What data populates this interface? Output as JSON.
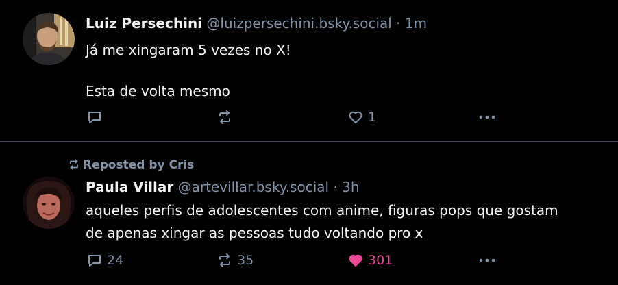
{
  "colors": {
    "background": "#000000",
    "text": "#f1f3f5",
    "muted": "#8193a8",
    "like": "#ec4899",
    "divider": "#2e4052"
  },
  "posts": [
    {
      "author_name": "Luiz Persechini",
      "handle": "@luizpersechini.bsky.social",
      "separator": "·",
      "time": "1m",
      "lines": [
        "Já me xingaram 5 vezes no X!",
        "Esta de volta mesmo"
      ],
      "actions": {
        "reply": {
          "icon": "reply-icon",
          "count": ""
        },
        "repost": {
          "icon": "repost-icon",
          "count": ""
        },
        "like": {
          "icon": "heart-outline-icon",
          "count": "1"
        },
        "more": {
          "icon": "more-icon"
        }
      }
    },
    {
      "reposted_by": "Reposted by Cris",
      "author_name": "Paula Villar",
      "handle": "@artevillar.bsky.social",
      "separator": "·",
      "time": "3h",
      "lines": [
        "aqueles perfis de adolescentes com anime, figuras pops que gostam",
        "de apenas xingar as pessoas tudo voltando pro x"
      ],
      "actions": {
        "reply": {
          "icon": "reply-icon",
          "count": "24"
        },
        "repost": {
          "icon": "repost-icon",
          "count": "35"
        },
        "like": {
          "icon": "heart-filled-icon",
          "count": "301"
        },
        "more": {
          "icon": "more-icon"
        }
      }
    }
  ]
}
